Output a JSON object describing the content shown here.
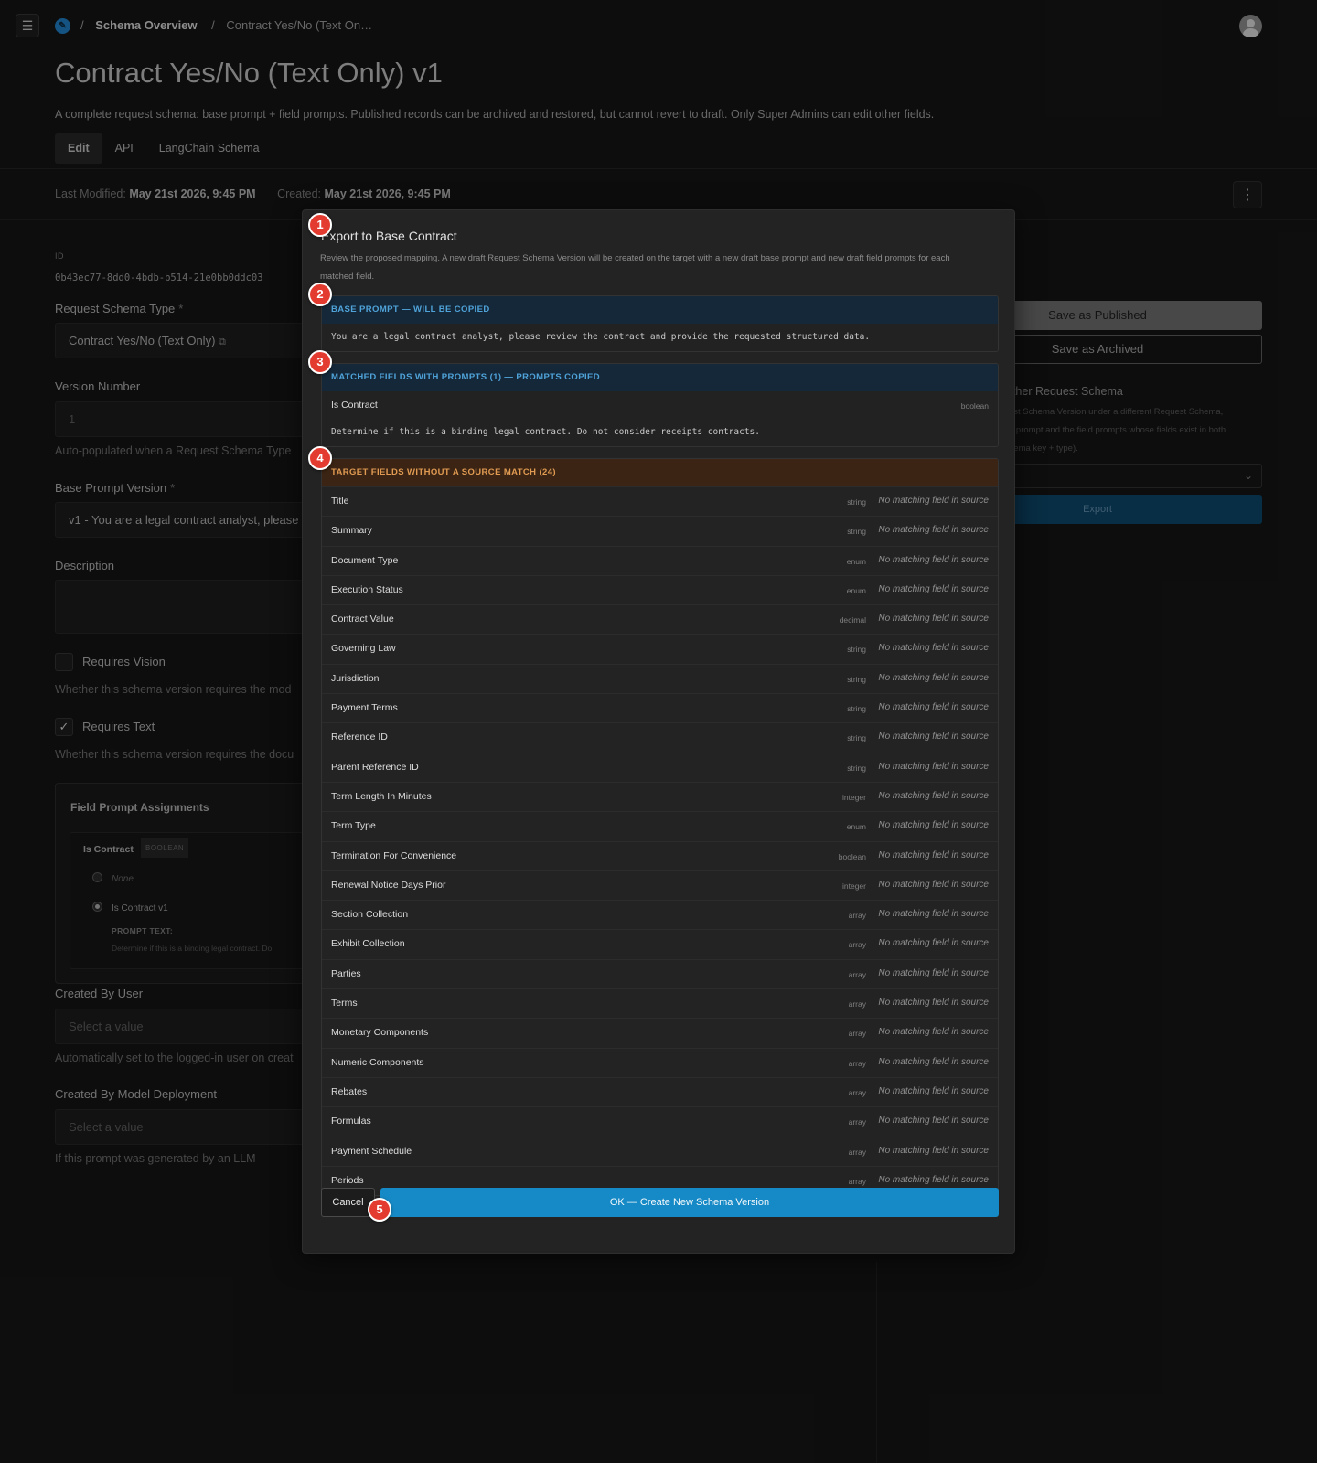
{
  "topbar": {
    "menu_icon": "hamburger-icon",
    "logo_icon": "app-logo-icon",
    "breadcrumb_sep": "/",
    "breadcrumb": [
      "Schema Overview",
      "Contract Yes/No (Text On…"
    ]
  },
  "page": {
    "title": "Contract Yes/No (Text Only) v1",
    "description": "A complete request schema: base prompt + field prompts. Published records can be archived and restored, but cannot revert to draft. Only Super Admins can edit other fields.",
    "tabs": [
      {
        "label": "Edit",
        "active": true
      },
      {
        "label": "API"
      },
      {
        "label": "LangChain Schema"
      }
    ],
    "last_modified_label": "Last Modified:",
    "last_modified": "May 21st 2026, 9:45 PM",
    "created_label": "Created:",
    "created": "May 21st 2026, 9:45 PM"
  },
  "form": {
    "id_label": "ID",
    "id_value": "0b43ec77-8dd0-4bdb-b514-21e0bb0ddc03",
    "schema_type_label": "Request Schema Type",
    "required_mark": "*",
    "schema_type_value": "Contract Yes/No (Text Only)",
    "version_label": "Version Number",
    "version_value": "1",
    "version_help": "Auto-populated when a Request Schema Type",
    "base_prompt_label": "Base Prompt Version",
    "base_prompt_value": "v1 - You are a legal contract analyst, please",
    "description_label": "Description",
    "requires_vision_label": "Requires Vision",
    "requires_vision_help": "Whether this schema version requires the mod",
    "requires_text_label": "Requires Text",
    "requires_text_check": "✓",
    "requires_text_help": "Whether this schema version requires the docu",
    "fpa_title": "Field Prompt Assignments",
    "fpa_field": "Is Contract",
    "fpa_badge": "BOOLEAN",
    "fpa_option_none": "None",
    "fpa_option_selected": "Is Contract v1",
    "fpa_prompt_label": "PROMPT TEXT:",
    "fpa_prompt_text": "Determine if this is a binding legal contract.  Do",
    "created_by_user_label": "Created By User",
    "created_by_user_placeholder": "Select a value",
    "created_by_user_help": "Automatically set to the logged-in user on creat",
    "created_by_model_label": "Created By Model Deployment",
    "created_by_model_placeholder": "Select a value",
    "created_by_model_help": "If this prompt was generated by an LLM"
  },
  "right_panel": {
    "save_published": "Save as Published",
    "save_archived": "Save as Archived",
    "title_partial": "other Request Schema",
    "desc_lines": [
      "est Schema Version under a different Request Schema,",
      "e prompt and the field prompts whose fields exist in both",
      "hema key + type)."
    ],
    "select_chevron": "⌄",
    "export_button": "Export"
  },
  "modal": {
    "title": "Export to Base Contract",
    "description": "Review the proposed mapping. A new draft Request Schema Version will be created on the target with a new draft base prompt and new draft field prompts for each matched field.",
    "base_prompt_header": "BASE PROMPT — WILL BE COPIED",
    "base_prompt_text": "You are a legal contract analyst, please review the contract and provide the requested structured data.",
    "matched_header": "MATCHED FIELDS WITH PROMPTS (1) — PROMPTS COPIED",
    "matched_fields": [
      {
        "name": "Is Contract",
        "type": "boolean",
        "prompt": "Determine if this is a binding legal contract.  Do not consider receipts contracts."
      }
    ],
    "unmatched_header": "TARGET FIELDS WITHOUT A SOURCE MATCH (24)",
    "unmatched_status": "No matching field in source",
    "unmatched_fields": [
      {
        "name": "Title",
        "type": "string"
      },
      {
        "name": "Summary",
        "type": "string"
      },
      {
        "name": "Document Type",
        "type": "enum"
      },
      {
        "name": "Execution Status",
        "type": "enum"
      },
      {
        "name": "Contract Value",
        "type": "decimal"
      },
      {
        "name": "Governing Law",
        "type": "string"
      },
      {
        "name": "Jurisdiction",
        "type": "string"
      },
      {
        "name": "Payment Terms",
        "type": "string"
      },
      {
        "name": "Reference ID",
        "type": "string"
      },
      {
        "name": "Parent Reference ID",
        "type": "string"
      },
      {
        "name": "Term Length In Minutes",
        "type": "integer"
      },
      {
        "name": "Term Type",
        "type": "enum"
      },
      {
        "name": "Termination For Convenience",
        "type": "boolean"
      },
      {
        "name": "Renewal Notice Days Prior",
        "type": "integer"
      },
      {
        "name": "Section Collection",
        "type": "array"
      },
      {
        "name": "Exhibit Collection",
        "type": "array"
      },
      {
        "name": "Parties",
        "type": "array"
      },
      {
        "name": "Terms",
        "type": "array"
      },
      {
        "name": "Monetary Components",
        "type": "array"
      },
      {
        "name": "Numeric Components",
        "type": "array"
      },
      {
        "name": "Rebates",
        "type": "array"
      },
      {
        "name": "Formulas",
        "type": "array"
      },
      {
        "name": "Payment Schedule",
        "type": "array"
      },
      {
        "name": "Periods",
        "type": "array"
      }
    ],
    "cancel_button": "Cancel",
    "ok_button": "OK — Create New Schema Version"
  },
  "markers": [
    "1",
    "2",
    "3",
    "4",
    "5"
  ]
}
